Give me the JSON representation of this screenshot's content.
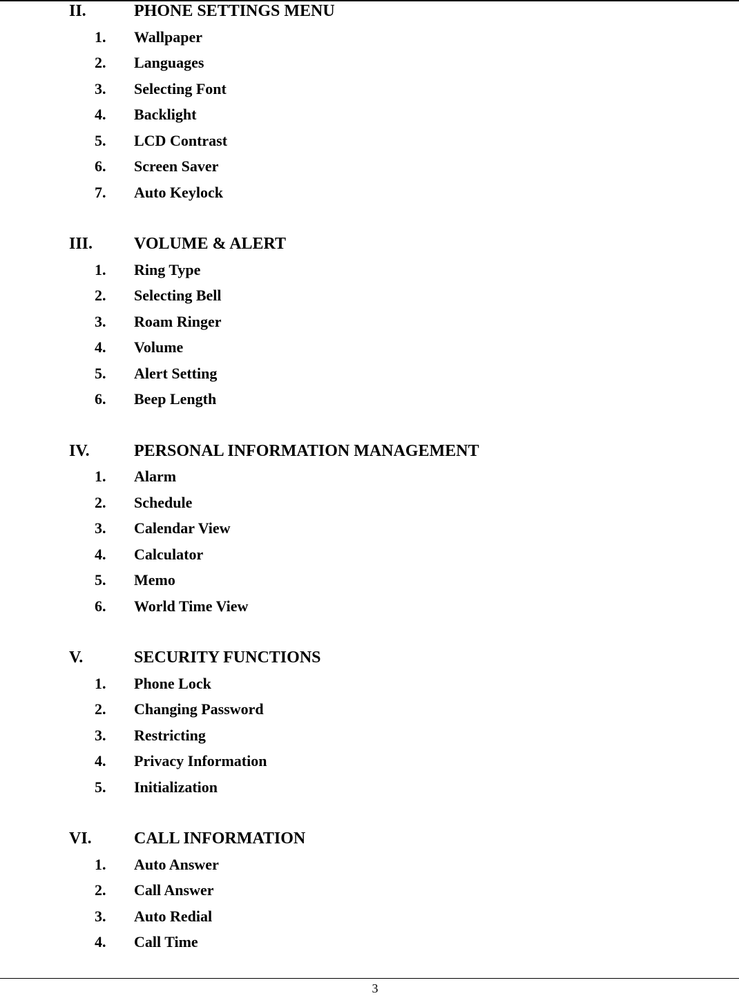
{
  "sections": [
    {
      "numeral": "II.",
      "title": "PHONE SETTINGS MENU",
      "items": [
        {
          "number": "1.",
          "label": "Wallpaper"
        },
        {
          "number": "2.",
          "label": "Languages"
        },
        {
          "number": "3.",
          "label": "Selecting Font"
        },
        {
          "number": "4.",
          "label": "Backlight"
        },
        {
          "number": "5.",
          "label": "LCD Contrast"
        },
        {
          "number": "6.",
          "label": "Screen Saver"
        },
        {
          "number": "7.",
          "label": "Auto Keylock"
        }
      ]
    },
    {
      "numeral": "III.",
      "title": "VOLUME & ALERT",
      "items": [
        {
          "number": "1.",
          "label": "Ring Type"
        },
        {
          "number": "2.",
          "label": "Selecting Bell"
        },
        {
          "number": "3.",
          "label": "Roam Ringer"
        },
        {
          "number": "4.",
          "label": "Volume"
        },
        {
          "number": "5.",
          "label": "Alert Setting"
        },
        {
          "number": "6.",
          "label": "Beep Length"
        }
      ]
    },
    {
      "numeral": "IV.",
      "title": "PERSONAL INFORMATION MANAGEMENT",
      "items": [
        {
          "number": "1.",
          "label": "Alarm"
        },
        {
          "number": "2.",
          "label": "Schedule"
        },
        {
          "number": "3.",
          "label": "Calendar View"
        },
        {
          "number": "4.",
          "label": "Calculator"
        },
        {
          "number": "5.",
          "label": "Memo"
        },
        {
          "number": "6.",
          "label": "World Time View"
        }
      ]
    },
    {
      "numeral": "V.",
      "title": "SECURITY FUNCTIONS",
      "items": [
        {
          "number": "1.",
          "label": "Phone Lock"
        },
        {
          "number": "2.",
          "label": "Changing Password"
        },
        {
          "number": "3.",
          "label": "Restricting"
        },
        {
          "number": "4.",
          "label": "Privacy Information"
        },
        {
          "number": "5.",
          "label": "Initialization"
        }
      ]
    },
    {
      "numeral": "VI.",
      "title": "CALL INFORMATION",
      "items": [
        {
          "number": "1.",
          "label": "Auto Answer"
        },
        {
          "number": "2.",
          "label": "Call Answer"
        },
        {
          "number": "3.",
          "label": "Auto Redial"
        },
        {
          "number": "4.",
          "label": "Call Time"
        }
      ]
    }
  ],
  "footer": {
    "page_number": "3"
  }
}
